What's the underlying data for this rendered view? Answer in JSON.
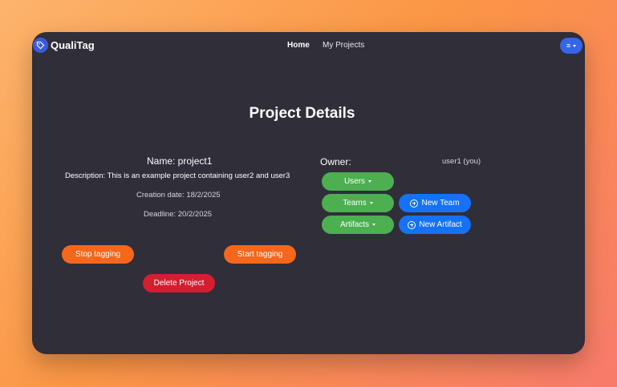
{
  "app": {
    "brand": "QualiTag"
  },
  "nav": {
    "home": "Home",
    "projects": "My Projects",
    "menu_icon": "≡"
  },
  "page": {
    "title": "Project Details"
  },
  "project": {
    "name": "Name: project1",
    "description": "Description: This is an example project containing user2 and user3",
    "creation": "Creation date: 18/2/2025",
    "deadline": "Deadline: 20/2/2025"
  },
  "owner": {
    "label": "Owner:",
    "value": "user1 (you)"
  },
  "buttons": {
    "users": "Users",
    "teams": "Teams",
    "artifacts": "Artifacts",
    "new_team": "New Team",
    "new_artifact": "New Artifact",
    "stop": "Stop tagging",
    "start": "Start tagging",
    "delete": "Delete Project"
  },
  "colors": {
    "window": "#2f2e39",
    "green": "#4caf50",
    "blue": "#1572f5",
    "orange": "#f6661b",
    "red": "#d31f30"
  }
}
